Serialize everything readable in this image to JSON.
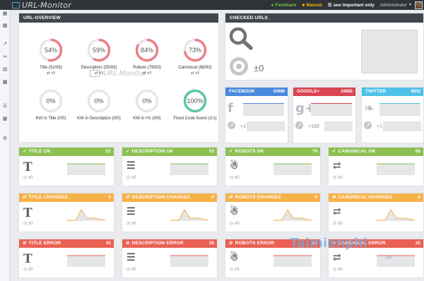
{
  "app": {
    "logo_text": "URL-Monitor"
  },
  "topbar": {
    "feedback": "Feedback",
    "manual": "Manual",
    "project": "seo important only",
    "user": "Administrator"
  },
  "overview": {
    "title": "URL-OVERVIEW",
    "gauges": [
      {
        "value": "54%",
        "pct": 0.54,
        "label": "Title (51/93)",
        "sub": "±3"
      },
      {
        "value": "59%",
        "pct": 0.59,
        "label": "Description (55/93)",
        "sub": "±3"
      },
      {
        "value": "84%",
        "pct": 0.84,
        "label": "Robots (79/93)",
        "sub": "±3"
      },
      {
        "value": "73%",
        "pct": 0.73,
        "label": "Canonical (68/93)",
        "sub": "±3"
      },
      {
        "value": "0%",
        "pct": 0,
        "label": "KW in Title (0/0)",
        "sub": ""
      },
      {
        "value": "0%",
        "pct": 0,
        "label": "KW in Description (0/0)",
        "sub": ""
      },
      {
        "value": "0%",
        "pct": 0,
        "label": "KW in H1 (0/0)",
        "sub": ""
      },
      {
        "value": "100%",
        "pct": 1,
        "label": "Fixed Code found (1/1)",
        "sub": ""
      }
    ],
    "watermark": "URL-Monitor"
  },
  "checked": {
    "title": "CHECKED URLS",
    "delta": "±0"
  },
  "social": [
    {
      "name": "FACEBOOK",
      "count": "10988",
      "delta": "+1",
      "color": "#4a89dc",
      "icon": "facebook-icon"
    },
    {
      "name": "GOOGLE+",
      "count": "24892",
      "delta": "+189",
      "color": "#da4453",
      "icon": "google-plus-icon"
    },
    {
      "name": "TWITTER",
      "count": "8932",
      "delta": "+1",
      "color": "#4fc1e9",
      "icon": "twitter-icon"
    }
  ],
  "cards": {
    "ok": [
      {
        "title": "TITLE OK",
        "count": "51",
        "delta": "±0",
        "icon": "text-icon"
      },
      {
        "title": "DESCRIPTION OK",
        "count": "55",
        "delta": "±0",
        "icon": "lines-icon"
      },
      {
        "title": "ROBOTS OK",
        "count": "79",
        "delta": "±0",
        "icon": "android-icon"
      },
      {
        "title": "CANONICAL OK",
        "count": "68",
        "delta": "±0",
        "icon": "exchange-icon"
      }
    ],
    "changes": [
      {
        "title": "TITLE CHANGES",
        "count": "0",
        "delta": "±0",
        "icon": "text-icon"
      },
      {
        "title": "DESCRIPTION CHANGES",
        "count": "0",
        "delta": "±0",
        "icon": "lines-icon"
      },
      {
        "title": "ROBOTS CHANGES",
        "count": "0",
        "delta": "±0",
        "icon": "android-icon"
      },
      {
        "title": "CANONICAL CHANGES",
        "count": "0",
        "delta": "±0",
        "icon": "exchange-icon"
      }
    ],
    "error": [
      {
        "title": "TITLE ERROR",
        "count": "42",
        "delta": "±0",
        "icon": "text-icon"
      },
      {
        "title": "DESCRIPTION ERROR",
        "count": "38",
        "delta": "±0",
        "icon": "lines-icon"
      },
      {
        "title": "ROBOTS ERROR",
        "count": "14",
        "delta": "±0",
        "icon": "android-icon"
      },
      {
        "title": "CANONICAL ERROR",
        "count": "25",
        "delta": "±0",
        "icon": "exchange-icon"
      }
    ]
  },
  "colors": {
    "gauge_red": "#ee7f86",
    "gauge_teal": "#5cc6a8",
    "gauge_track": "#e4e6e8",
    "ok": "#8cc152",
    "changes": "#f6b24a",
    "error": "#ea6153"
  },
  "site_watermark": {
    "text": "Taimienphi",
    "suffix": ".vn"
  }
}
